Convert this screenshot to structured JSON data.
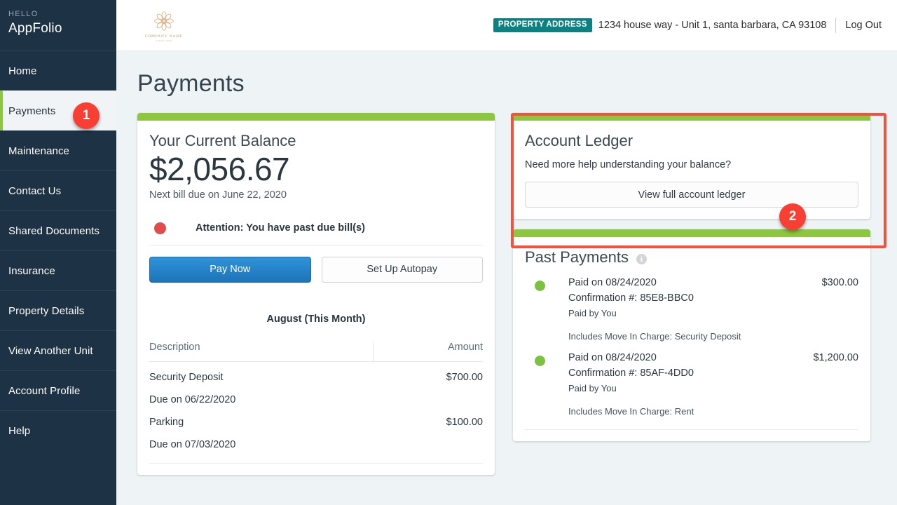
{
  "sidebar": {
    "hello_label": "HELLO",
    "account_name": "AppFolio",
    "items": [
      {
        "label": "Home",
        "active": false
      },
      {
        "label": "Payments",
        "active": true
      },
      {
        "label": "Maintenance",
        "active": false
      },
      {
        "label": "Contact Us",
        "active": false
      },
      {
        "label": "Shared Documents",
        "active": false
      },
      {
        "label": "Insurance",
        "active": false
      },
      {
        "label": "Property Details",
        "active": false
      },
      {
        "label": "View Another Unit",
        "active": false
      },
      {
        "label": "Account Profile",
        "active": false
      },
      {
        "label": "Help",
        "active": false
      }
    ]
  },
  "topbar": {
    "logo_name": "COMPANY NAME",
    "logo_sub": "SINCE 1984",
    "address_badge": "PROPERTY ADDRESS",
    "address": "1234 house way - Unit 1, santa barbara, CA 93108",
    "logout_label": "Log Out"
  },
  "page": {
    "title": "Payments"
  },
  "balance_card": {
    "title": "Your Current Balance",
    "amount": "$2,056.67",
    "next_bill": "Next bill due on June 22, 2020",
    "attention": "Attention: You have past due bill(s)",
    "pay_now_label": "Pay Now",
    "autopay_label": "Set Up Autopay",
    "month_heading": "August (This Month)",
    "columns": {
      "description": "Description",
      "amount": "Amount"
    },
    "charges": [
      {
        "description": "Security Deposit",
        "due": "Due on 06/22/2020",
        "amount": "$700.00"
      },
      {
        "description": "Parking",
        "due": "Due on 07/03/2020",
        "amount": "$100.00"
      }
    ]
  },
  "ledger_card": {
    "title": "Account Ledger",
    "subtitle": "Need more help understanding your balance?",
    "button_label": "View full account ledger"
  },
  "past_payments": {
    "title": "Past Payments",
    "info_icon_glyph": "i",
    "items": [
      {
        "paid_on": "Paid on 08/24/2020",
        "confirmation": "Confirmation #: 85E8-BBC0",
        "paid_by": "Paid by You",
        "includes": "Includes Move In Charge: Security Deposit",
        "amount": "$300.00"
      },
      {
        "paid_on": "Paid on 08/24/2020",
        "confirmation": "Confirmation #: 85AF-4DD0",
        "paid_by": "Paid by You",
        "includes": "Includes Move In Charge: Rent",
        "amount": "$1,200.00"
      }
    ]
  },
  "annotations": {
    "badge1": "1",
    "badge2": "2"
  },
  "colors": {
    "sidebar_bg": "#1d3244",
    "card_accent_green": "#8dc63f",
    "primary_blue": "#2f92d8",
    "badge_red": "#f93f33",
    "teal_badge": "#0d8181",
    "due_red": "#d3342c",
    "paid_green": "#7cc242"
  }
}
